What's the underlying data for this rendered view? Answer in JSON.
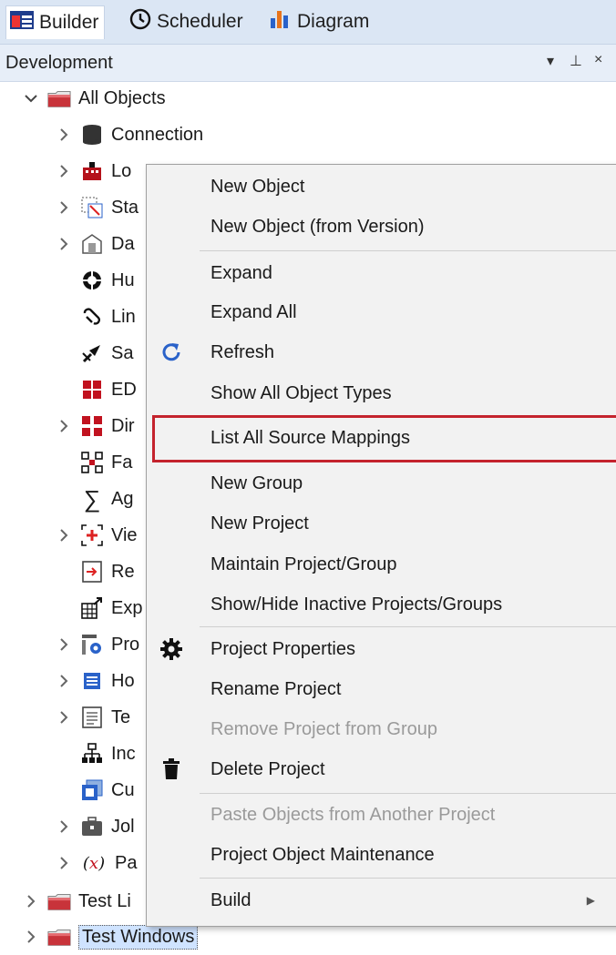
{
  "tabs": [
    {
      "label": "Builder",
      "icon": "builder-icon"
    },
    {
      "label": "Scheduler",
      "icon": "clock-icon"
    },
    {
      "label": "Diagram",
      "icon": "chart-icon"
    }
  ],
  "panel": {
    "title": "Development",
    "controls": [
      "▾",
      "⊥",
      "×"
    ]
  },
  "tree": {
    "root": "All Objects",
    "children": [
      {
        "label": "Connection",
        "icon": "connection-icon",
        "expandable": true
      },
      {
        "label": "Lo",
        "icon": "load-icon",
        "expandable": true
      },
      {
        "label": "Sta",
        "icon": "stage-icon",
        "expandable": true
      },
      {
        "label": "Da",
        "icon": "datastore-icon",
        "expandable": true
      },
      {
        "label": "Hu",
        "icon": "hub-icon",
        "expandable": false
      },
      {
        "label": "Lin",
        "icon": "link-icon",
        "expandable": false
      },
      {
        "label": "Sa",
        "icon": "satellite-icon",
        "expandable": false
      },
      {
        "label": "ED",
        "icon": "edw-icon",
        "expandable": false
      },
      {
        "label": "Dir",
        "icon": "dimension-icon",
        "expandable": true
      },
      {
        "label": "Fa",
        "icon": "fact-icon",
        "expandable": false
      },
      {
        "label": "Ag",
        "icon": "sigma-icon",
        "expandable": false
      },
      {
        "label": "Vie",
        "icon": "view-icon",
        "expandable": true
      },
      {
        "label": "Re",
        "icon": "retro-icon",
        "expandable": false
      },
      {
        "label": "Exp",
        "icon": "export-icon",
        "expandable": false
      },
      {
        "label": "Pro",
        "icon": "procedure-icon",
        "expandable": true
      },
      {
        "label": "Ho",
        "icon": "host-script-icon",
        "expandable": true
      },
      {
        "label": "Te",
        "icon": "template-icon",
        "expandable": true
      },
      {
        "label": "Inc",
        "icon": "index-icon",
        "expandable": false
      },
      {
        "label": "Cu",
        "icon": "cube-icon",
        "expandable": false
      },
      {
        "label": "Jol",
        "icon": "job-icon",
        "expandable": true
      },
      {
        "label": "Pa",
        "icon": "parameter-icon",
        "expandable": true
      }
    ],
    "siblings": [
      {
        "label": "Test Li"
      },
      {
        "label": "Test Windows",
        "selected": true
      }
    ]
  },
  "menu": {
    "items": [
      {
        "label": "New Object"
      },
      {
        "label": "New Object (from Version)"
      },
      {
        "label": "Expand"
      },
      {
        "label": "Expand All"
      },
      {
        "label": "Refresh",
        "icon": "refresh-icon"
      },
      {
        "label": "Show All Object Types"
      },
      {
        "label": "List All Source Mappings",
        "highlighted": true
      },
      {
        "label": "New Group"
      },
      {
        "label": "New Project"
      },
      {
        "label": "Maintain Project/Group"
      },
      {
        "label": "Show/Hide Inactive Projects/Groups"
      },
      {
        "label": "Project Properties",
        "icon": "gear-icon"
      },
      {
        "label": "Rename Project"
      },
      {
        "label": "Remove Project from Group",
        "disabled": true
      },
      {
        "label": "Delete Project",
        "icon": "trash-icon"
      },
      {
        "label": "Paste Objects from Another Project",
        "disabled": true
      },
      {
        "label": "Project Object Maintenance"
      },
      {
        "label": "Build",
        "submenu": true
      }
    ]
  },
  "colors": {
    "highlight_border": "#c4232d",
    "tab_bg": "#dbe6f4",
    "menu_bg": "#f2f2f2"
  }
}
